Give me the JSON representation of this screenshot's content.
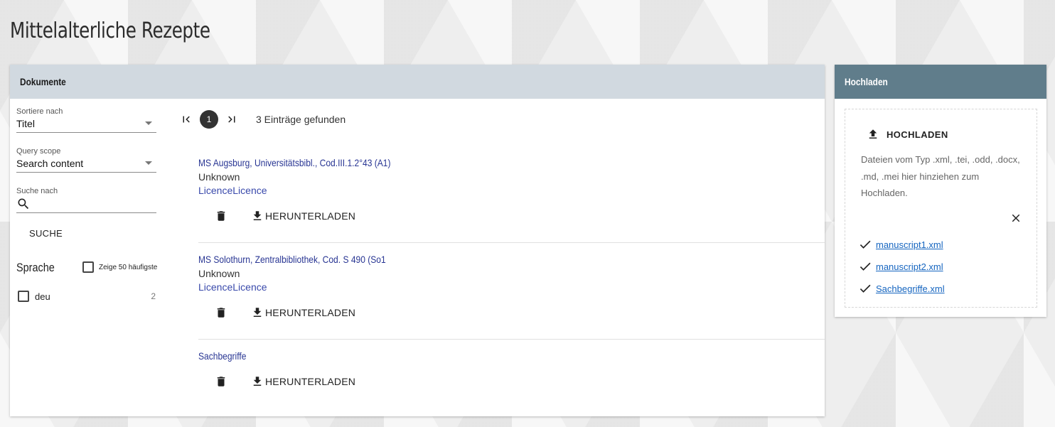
{
  "page": {
    "title": "Mittelalterliche Rezepte"
  },
  "documents_panel": {
    "header": "Dokumente",
    "sort": {
      "label": "Sortiere nach",
      "value": "Titel"
    },
    "scope": {
      "label": "Query scope",
      "value": "Search content"
    },
    "search": {
      "label": "Suche nach",
      "value": ""
    },
    "search_button": "SUCHE",
    "facet": {
      "title": "Sprache",
      "toggle_label": "Zeige 50 häufigste",
      "items": [
        {
          "name": "deu",
          "count": "2"
        }
      ]
    },
    "pagination": {
      "current_page": "1",
      "result_count": "3 Einträge gefunden"
    },
    "documents": [
      {
        "title": "MS Augsburg, Universitätsbibl., Cod.III.1.2°43 (A1)",
        "author": "Unknown",
        "licence": "LicenceLicence",
        "download_label": "HERUNTERLADEN"
      },
      {
        "title": "MS Solothurn, Zentralbibliothek, Cod. S 490 (So1",
        "author": "Unknown",
        "licence": "LicenceLicence",
        "download_label": "HERUNTERLADEN"
      },
      {
        "title": "Sachbegriffe",
        "author": "",
        "licence": "",
        "download_label": "HERUNTERLADEN"
      }
    ]
  },
  "upload_panel": {
    "header": "Hochladen",
    "button_label": "HOCHLADEN",
    "description": "Dateien vom Typ .xml, .tei, .odd, .docx, .md, .mei hier hinziehen zum Hochladen.",
    "files": [
      "manuscript1.xml",
      "manuscript2.xml",
      "Sachbegriffe.xml"
    ]
  },
  "icons": {
    "search": "search-icon",
    "first_page": "first-page-icon",
    "last_page": "last-page-icon",
    "delete": "trash-icon",
    "download": "download-icon",
    "upload": "upload-icon",
    "close": "close-icon",
    "check": "check-icon"
  },
  "colors": {
    "docs_header_bg": "#d1d9e0",
    "upload_header_bg": "#607d8b",
    "link": "#283593",
    "file_link": "#1565c0"
  }
}
